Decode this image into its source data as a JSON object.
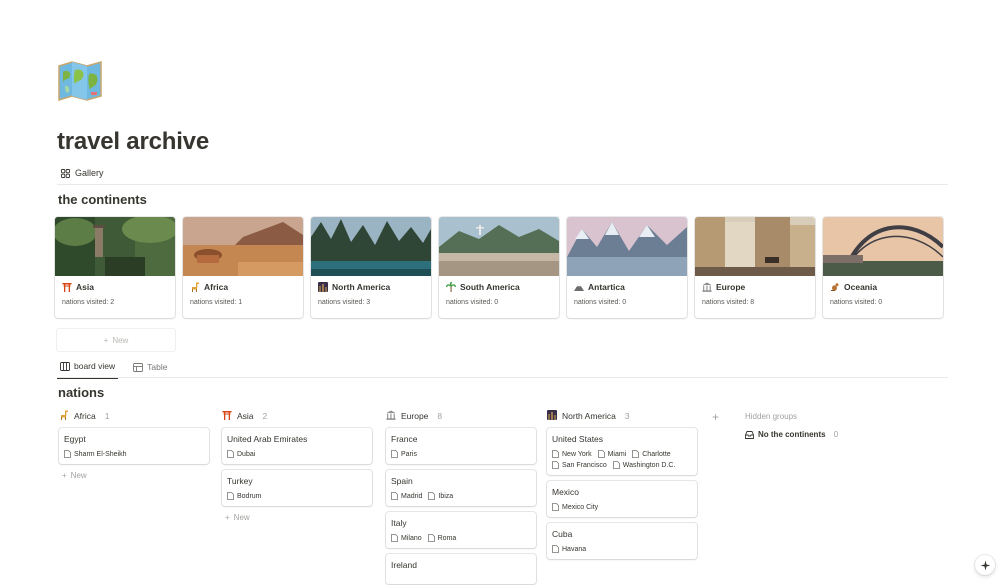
{
  "page": {
    "icon": "world-map-icon",
    "title": "travel archive",
    "view_label": "Gallery"
  },
  "continents": {
    "title": "the continents",
    "cards": [
      {
        "name": "Asia",
        "emoji": "torii-icon",
        "property": "nations visited: 2"
      },
      {
        "name": "Africa",
        "emoji": "giraffe-icon",
        "property": "nations visited: 1"
      },
      {
        "name": "North America",
        "emoji": "cityscape-icon",
        "property": "nations visited: 3"
      },
      {
        "name": "South America",
        "emoji": "palm-tree-icon",
        "property": "nations visited: 0"
      },
      {
        "name": "Antartica",
        "emoji": "snowy-mountain-icon",
        "property": "nations visited: 0"
      },
      {
        "name": "Europe",
        "emoji": "classical-building-icon",
        "property": "nations visited: 8"
      },
      {
        "name": "Oceania",
        "emoji": "kangaroo-icon",
        "property": "nations visited: 0"
      }
    ],
    "new_label": "New"
  },
  "tabs": [
    {
      "label": "board view",
      "icon": "board-icon",
      "active": true
    },
    {
      "label": "Table",
      "icon": "table-icon",
      "active": false
    }
  ],
  "nations": {
    "title": "nations",
    "columns": [
      {
        "name": "Africa",
        "emoji": "giraffe-icon",
        "count": "1",
        "cards": [
          {
            "title": "Egypt",
            "relations": [
              "Sharm El-Sheikh"
            ]
          }
        ],
        "new_label": "New"
      },
      {
        "name": "Asia",
        "emoji": "torii-icon",
        "count": "2",
        "cards": [
          {
            "title": "United Arab Emirates",
            "relations": [
              "Dubai"
            ]
          },
          {
            "title": "Turkey",
            "relations": [
              "Bodrum"
            ]
          }
        ],
        "new_label": "New"
      },
      {
        "name": "Europe",
        "emoji": "classical-building-icon",
        "count": "8",
        "cards": [
          {
            "title": "France",
            "relations": [
              "Paris"
            ]
          },
          {
            "title": "Spain",
            "relations": [
              "Madrid",
              "Ibiza"
            ]
          },
          {
            "title": "Italy",
            "relations": [
              "Milano",
              "Roma"
            ]
          },
          {
            "title": "Ireland",
            "relations": []
          }
        ],
        "new_label": ""
      },
      {
        "name": "North America",
        "emoji": "cityscape-icon",
        "count": "3",
        "cards": [
          {
            "title": "United States",
            "relations": [
              "New York",
              "Miami",
              "Charlotte",
              "San Francisco",
              "Washington D.C."
            ]
          },
          {
            "title": "Mexico",
            "relations": [
              "Mexico City"
            ]
          },
          {
            "title": "Cuba",
            "relations": [
              "Havana"
            ]
          }
        ],
        "new_label": ""
      }
    ],
    "hidden_groups_label": "Hidden groups",
    "no_group_label": "No the continents",
    "no_group_count": "0"
  }
}
